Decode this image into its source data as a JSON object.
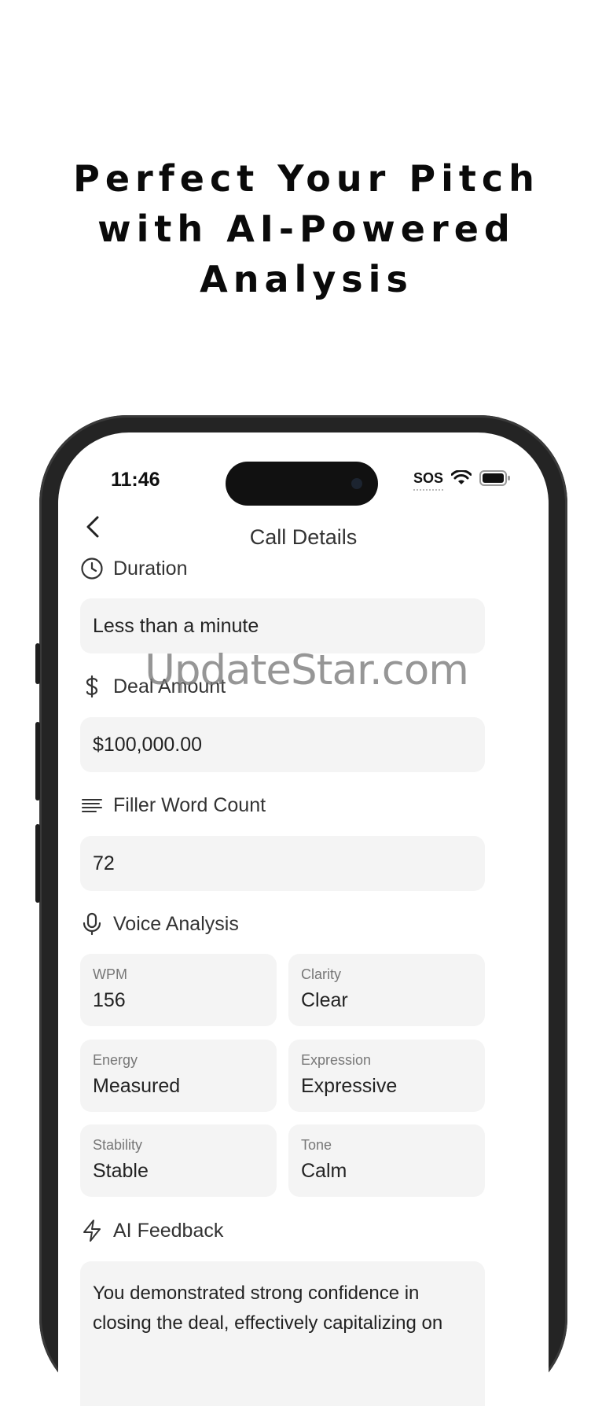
{
  "headline": {
    "line1": "Perfect Your Pitch",
    "line2": "with AI-Powered",
    "line3": "Analysis"
  },
  "status_bar": {
    "time": "11:46",
    "sos": "SOS"
  },
  "nav": {
    "title": "Call Details"
  },
  "duration": {
    "label": "Duration",
    "value": "Less than a minute"
  },
  "deal_amount": {
    "label": "Deal Amount",
    "value": "$100,000.00"
  },
  "filler": {
    "label": "Filler Word Count",
    "value": "72"
  },
  "voice": {
    "label": "Voice Analysis",
    "metrics": [
      {
        "key": "WPM",
        "value": "156"
      },
      {
        "key": "Clarity",
        "value": "Clear"
      },
      {
        "key": "Energy",
        "value": "Measured"
      },
      {
        "key": "Expression",
        "value": "Expressive"
      },
      {
        "key": "Stability",
        "value": "Stable"
      },
      {
        "key": "Tone",
        "value": "Calm"
      }
    ]
  },
  "ai_feedback": {
    "label": "AI Feedback",
    "text": "You demonstrated strong confidence in closing the deal, effectively capitalizing on"
  },
  "watermark": "UpdateStar.com",
  "icons": [
    "clock-icon",
    "dollar-icon",
    "lines-icon",
    "microphone-icon",
    "bolt-icon",
    "back-chevron-icon",
    "wifi-icon",
    "battery-icon"
  ]
}
